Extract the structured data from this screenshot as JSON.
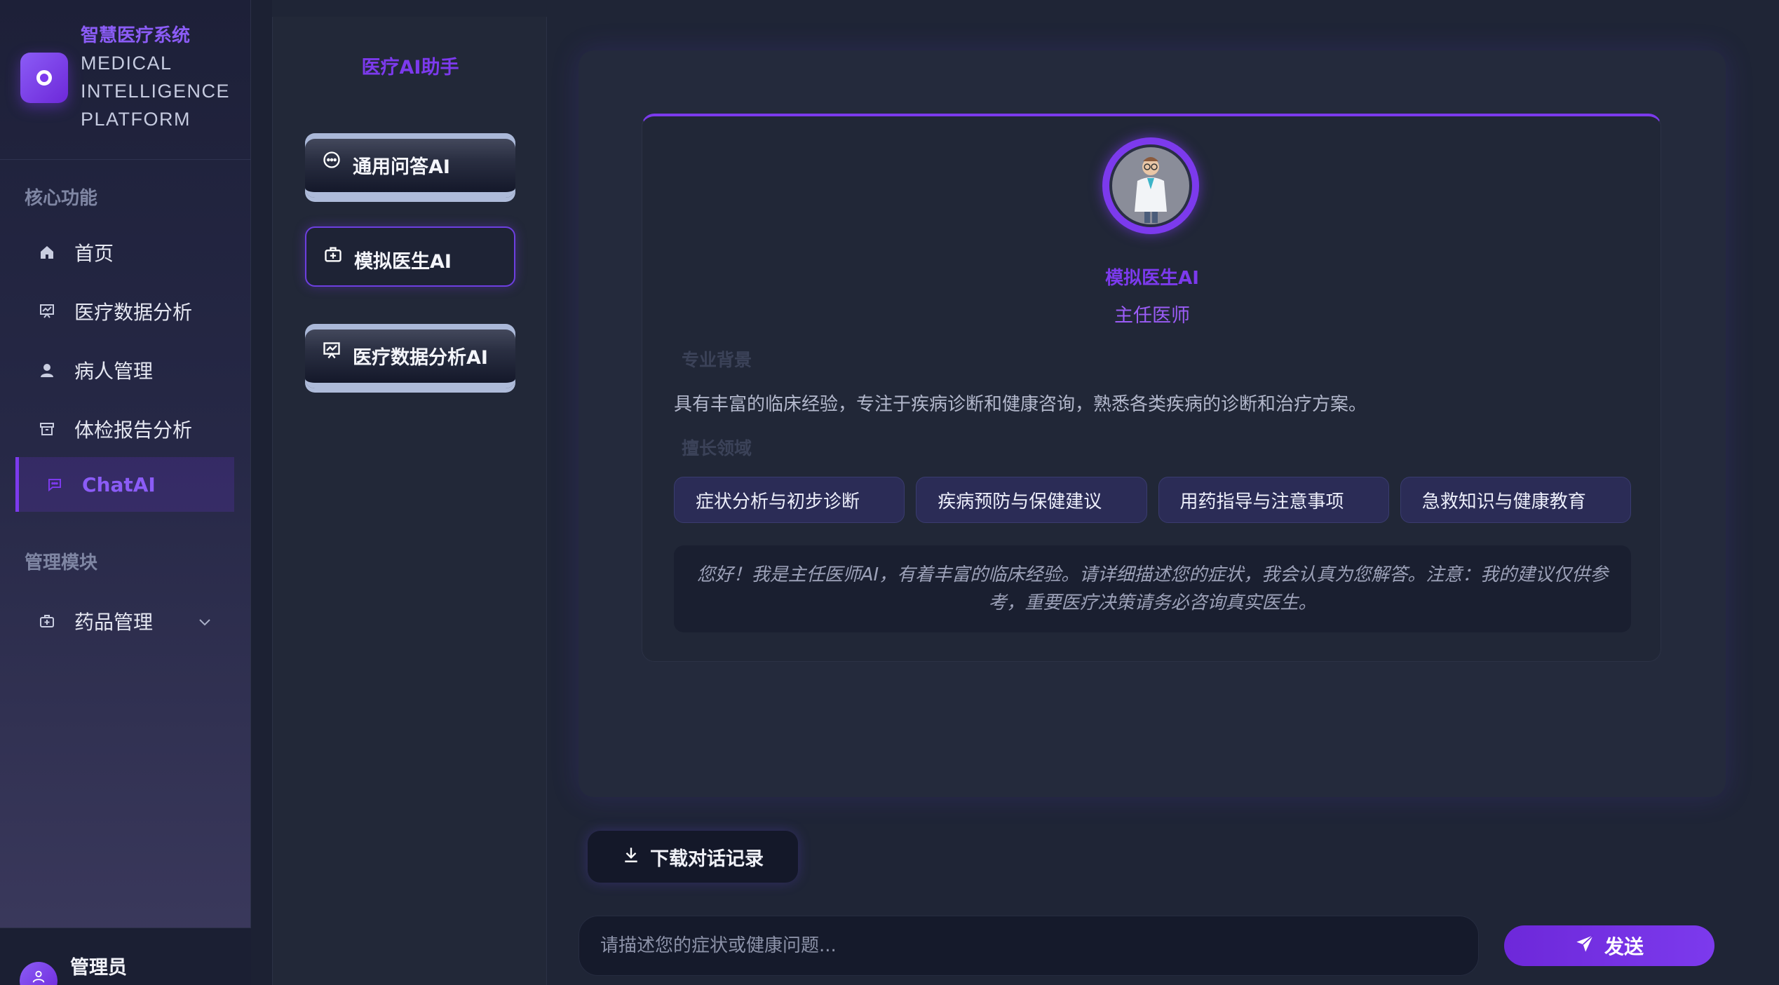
{
  "brand": {
    "title": "智慧医疗系统",
    "subtitle": "MEDICAL INTELLIGENCE PLATFORM",
    "accent": "#7c3aed"
  },
  "sidebar": {
    "section_core": "核心功能",
    "section_admin": "管理模块",
    "items": [
      {
        "label": "首页",
        "icon": "home-icon"
      },
      {
        "label": "医疗数据分析",
        "icon": "chart-board-icon"
      },
      {
        "label": "病人管理",
        "icon": "user-icon"
      },
      {
        "label": "体检报告分析",
        "icon": "archive-icon"
      },
      {
        "label": "ChatAI",
        "icon": "chat-icon",
        "active": true
      }
    ],
    "admin_items": [
      {
        "label": "药品管理",
        "icon": "medicine-box-icon",
        "expandable": true
      }
    ],
    "user": {
      "name": "管理员"
    }
  },
  "assistants": {
    "title": "医疗AI助手",
    "items": [
      {
        "label": "通用问答AI",
        "icon": "chat-bubble-icon"
      },
      {
        "label": "模拟医生AI",
        "icon": "medical-kit-icon",
        "active": true
      },
      {
        "label": "医疗数据分析AI",
        "icon": "chart-board-icon"
      }
    ]
  },
  "doctor": {
    "name": "模拟医生AI",
    "title": "主任医师",
    "background_label": "专业背景",
    "background_text": "具有丰富的临床经验，专注于疾病诊断和健康咨询，熟悉各类疾病的诊断和治疗方案。",
    "specialty_label": "擅长领域",
    "specialties": [
      "症状分析与初步诊断",
      "疾病预防与保健建议",
      "用药指导与注意事项",
      "急救知识与健康教育"
    ],
    "greeting": "您好！我是主任医师AI，有着丰富的临床经验。请详细描述您的症状，我会认真为您解答。注意：我的建议仅供参考，重要医疗决策请务必咨询真实医生。"
  },
  "actions": {
    "download_label": "下载对话记录",
    "input_placeholder": "请描述您的症状或健康问题...",
    "send_label": "发送"
  }
}
